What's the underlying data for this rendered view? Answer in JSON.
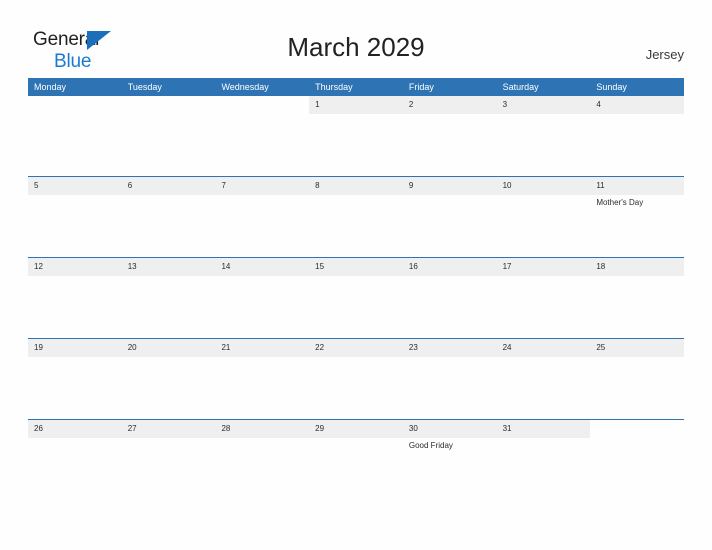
{
  "brand": {
    "name_part1": "General",
    "name_part2": "Blue",
    "flag_icon": "triangle-flag-icon",
    "color_dark": "#231f20",
    "color_blue": "#1b7ace"
  },
  "header": {
    "title": "March 2029",
    "region": "Jersey"
  },
  "theme": {
    "header_blue": "#2e74b5",
    "band_gray": "#efefef",
    "text_dark": "#2b2b2b",
    "page_bg": "#fefefe"
  },
  "calendar": {
    "month": "March",
    "year": "2029",
    "weekday_headers": [
      "Monday",
      "Tuesday",
      "Wednesday",
      "Thursday",
      "Friday",
      "Saturday",
      "Sunday"
    ],
    "weeks": [
      [
        {
          "num": "",
          "events": []
        },
        {
          "num": "",
          "events": []
        },
        {
          "num": "",
          "events": []
        },
        {
          "num": "1",
          "events": []
        },
        {
          "num": "2",
          "events": []
        },
        {
          "num": "3",
          "events": []
        },
        {
          "num": "4",
          "events": []
        }
      ],
      [
        {
          "num": "5",
          "events": []
        },
        {
          "num": "6",
          "events": []
        },
        {
          "num": "7",
          "events": []
        },
        {
          "num": "8",
          "events": []
        },
        {
          "num": "9",
          "events": []
        },
        {
          "num": "10",
          "events": []
        },
        {
          "num": "11",
          "events": [
            "Mother's Day"
          ]
        }
      ],
      [
        {
          "num": "12",
          "events": []
        },
        {
          "num": "13",
          "events": []
        },
        {
          "num": "14",
          "events": []
        },
        {
          "num": "15",
          "events": []
        },
        {
          "num": "16",
          "events": []
        },
        {
          "num": "17",
          "events": []
        },
        {
          "num": "18",
          "events": []
        }
      ],
      [
        {
          "num": "19",
          "events": []
        },
        {
          "num": "20",
          "events": []
        },
        {
          "num": "21",
          "events": []
        },
        {
          "num": "22",
          "events": []
        },
        {
          "num": "23",
          "events": []
        },
        {
          "num": "24",
          "events": []
        },
        {
          "num": "25",
          "events": []
        }
      ],
      [
        {
          "num": "26",
          "events": []
        },
        {
          "num": "27",
          "events": []
        },
        {
          "num": "28",
          "events": []
        },
        {
          "num": "29",
          "events": []
        },
        {
          "num": "30",
          "events": [
            "Good Friday"
          ]
        },
        {
          "num": "31",
          "events": []
        },
        {
          "num": "",
          "events": []
        }
      ]
    ]
  }
}
